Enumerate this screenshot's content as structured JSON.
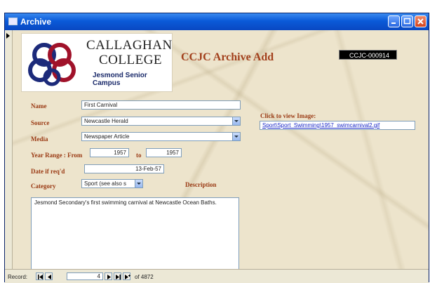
{
  "window": {
    "title": "Archive"
  },
  "logo": {
    "line1": "CALLAGHAN",
    "line2": "COLLEGE",
    "line3": "Jesmond Senior Campus",
    "colors": {
      "blue": "#1c2a7a",
      "red": "#a0122a"
    }
  },
  "form": {
    "heading": "CCJC Archive Add",
    "record_id": "CCJC-000914",
    "name": {
      "label": "Name",
      "value": "First Carnival"
    },
    "source": {
      "label": "Source",
      "value": "Newcastle Herald"
    },
    "media": {
      "label": "Media",
      "value": "Newspaper Article"
    },
    "year_range": {
      "label": "Year Range : From",
      "from": "1957",
      "to_label": "to",
      "to": "1957"
    },
    "date_received": {
      "label": "Date if req'd",
      "value": "13-Feb-57"
    },
    "category": {
      "label": "Category",
      "value": "Sport (see also s"
    },
    "description": {
      "label": "Description",
      "value": "Jesmond Secondary's first swimming carnival at Newcastle Ocean Baths."
    },
    "image": {
      "label": "Click to view Image:",
      "link": "Sport\\Sport_Swimming\\1957_swimcarnival2.gif"
    }
  },
  "navigation": {
    "record_label": "Record:",
    "current": "4",
    "of_label": "of",
    "total": "4872"
  },
  "colors": {
    "label_text": "#9a3a14",
    "heading": "#a2401c",
    "titlebar": "#0a5ad8"
  }
}
